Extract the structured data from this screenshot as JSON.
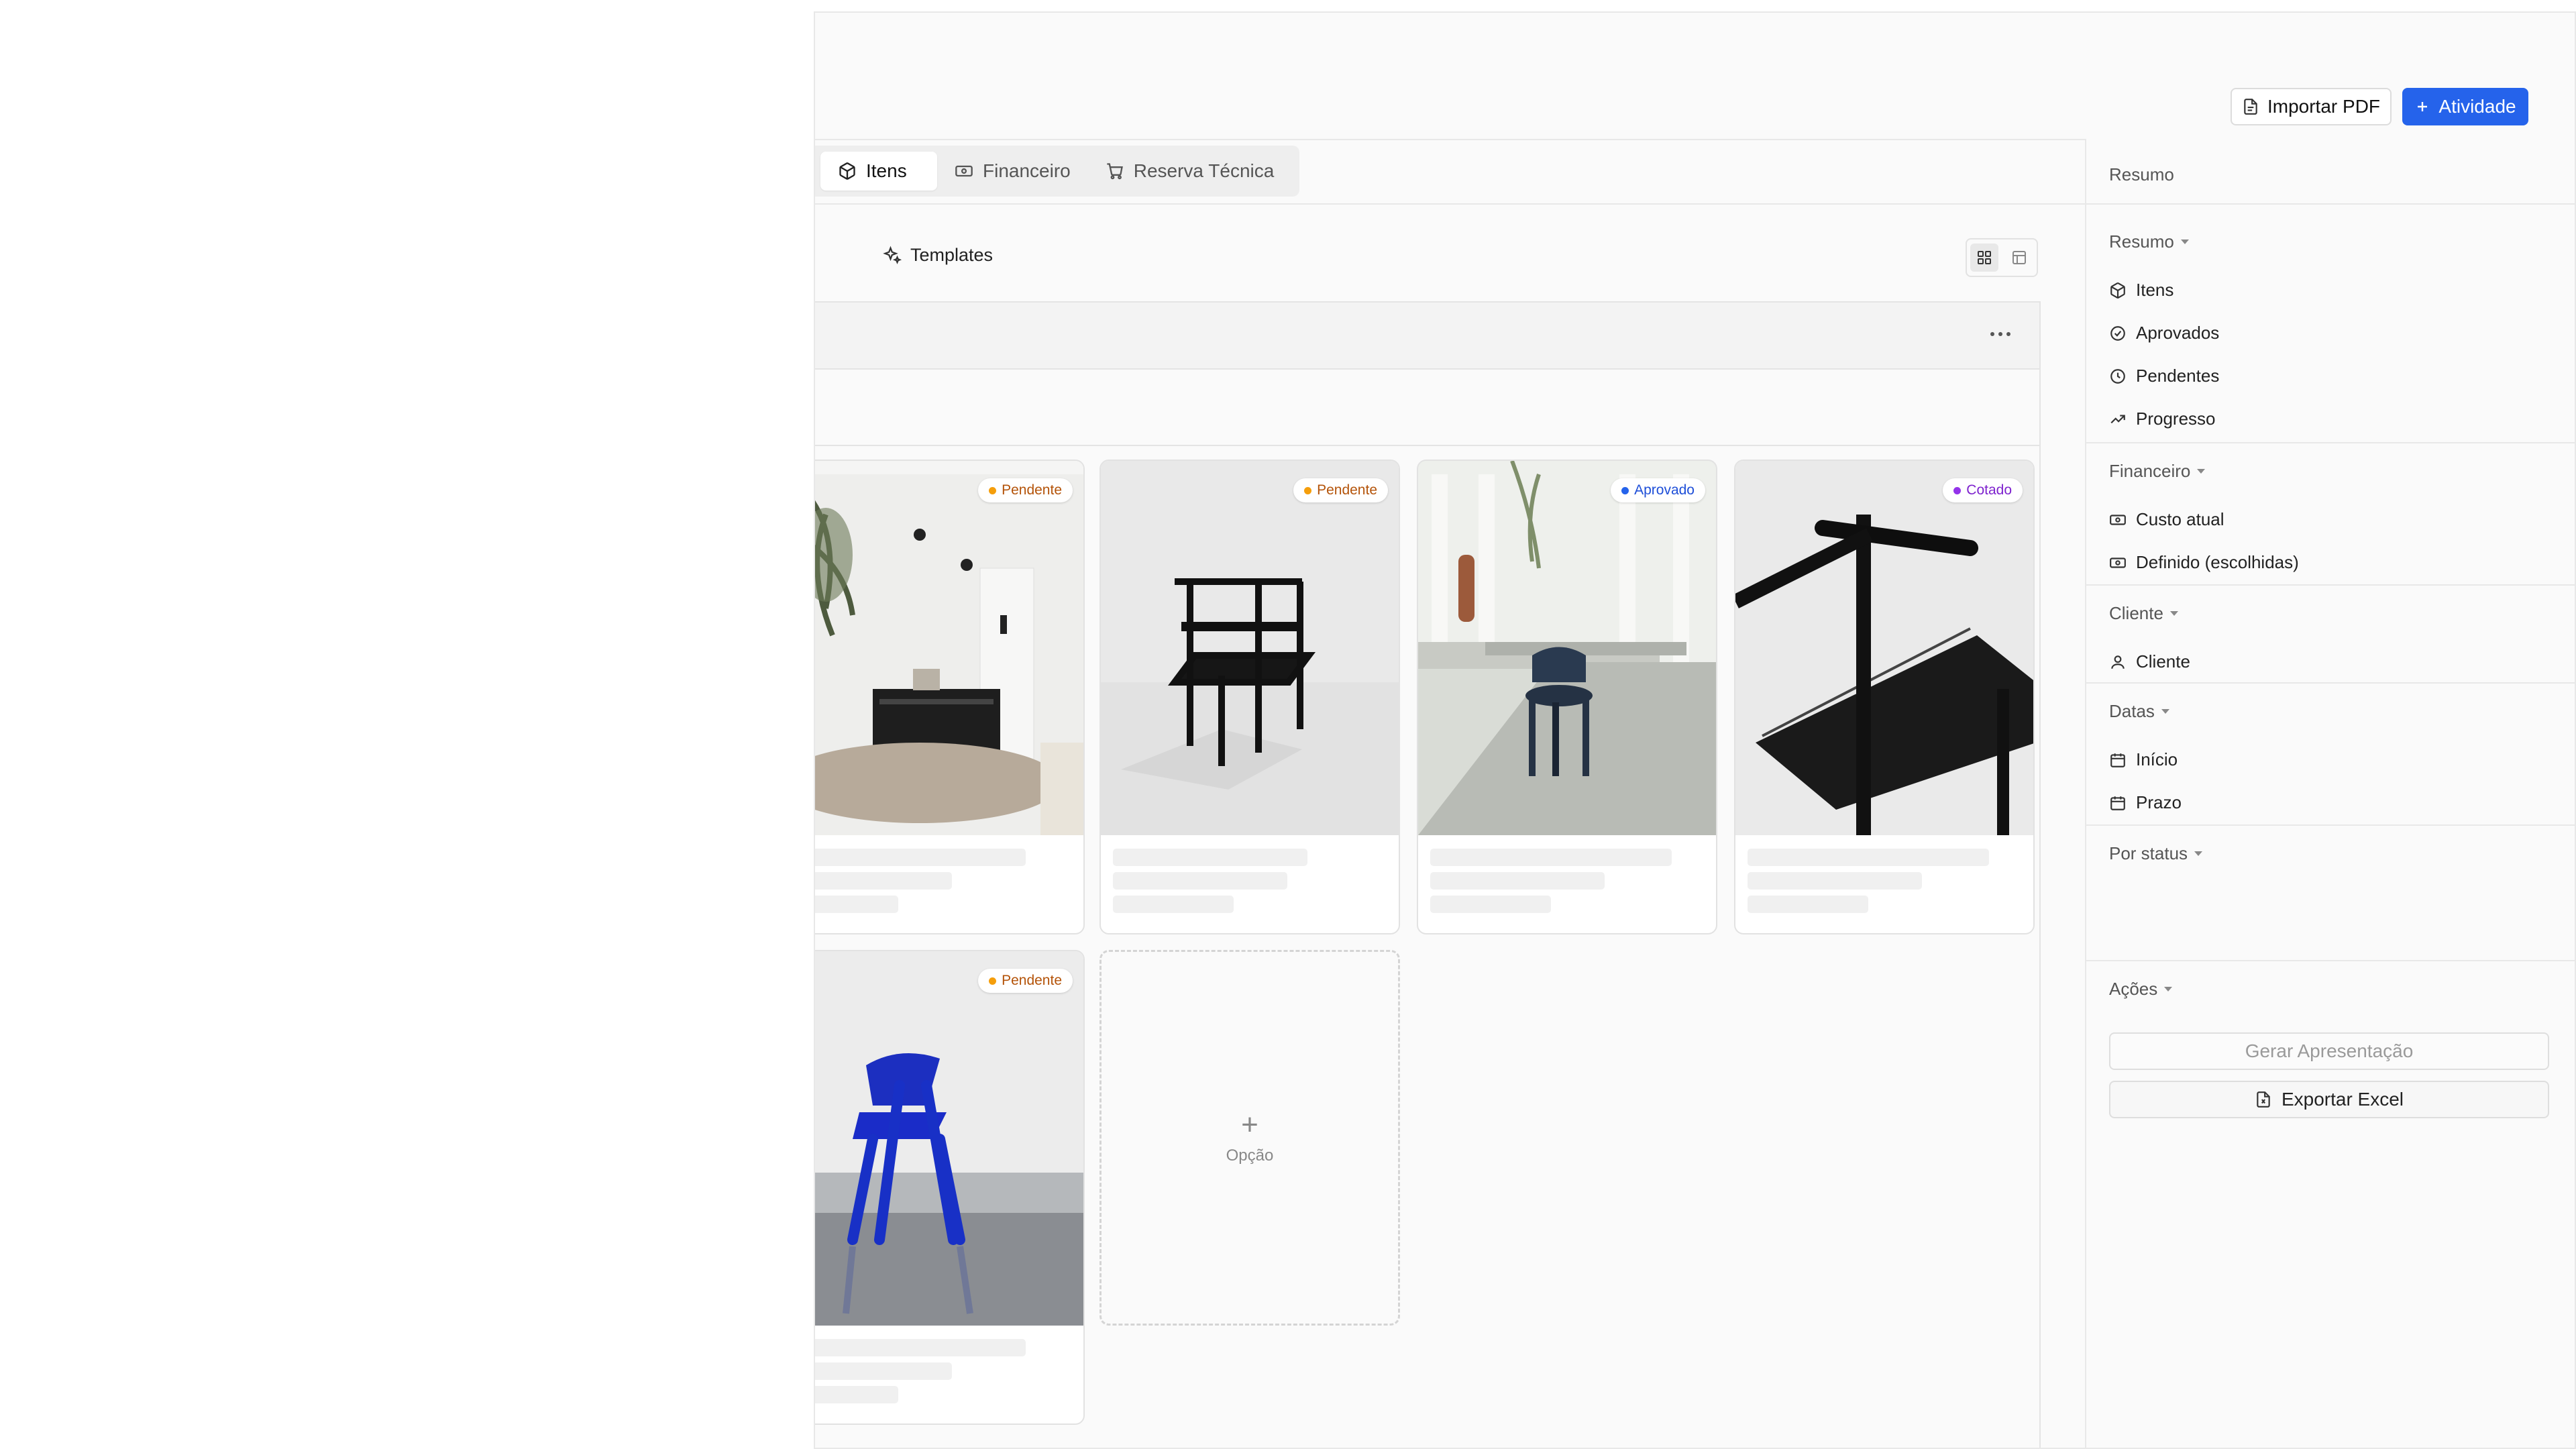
{
  "toolbar": {
    "import_pdf_label": "Importar PDF",
    "activity_label": "Atividade"
  },
  "tabs": [
    {
      "label": "Itens",
      "icon": "package-icon",
      "active": true
    },
    {
      "label": "Financeiro",
      "icon": "money-icon",
      "active": false
    },
    {
      "label": "Reserva Técnica",
      "icon": "cart-icon",
      "active": false
    }
  ],
  "templates_label": "Templates",
  "view_modes": [
    "grid",
    "table"
  ],
  "cards": [
    {
      "status": "Pendente",
      "status_color": "#f59e0b",
      "text_color": "#b45309",
      "image": "living room with bench and plant"
    },
    {
      "status": "Pendente",
      "status_color": "#f59e0b",
      "text_color": "#b45309",
      "image": "black chair"
    },
    {
      "status": "Aprovado",
      "status_color": "#2563eb",
      "text_color": "#1d4ed8",
      "image": "blue round stool in bright room"
    },
    {
      "status": "Cotado",
      "status_color": "#9333ea",
      "text_color": "#7e22ce",
      "image": "black chair close-up"
    },
    {
      "status": "Pendente",
      "status_color": "#f59e0b",
      "text_color": "#b45309",
      "image": "blue chair"
    }
  ],
  "add_option_label": "Opção",
  "panel": {
    "title": "Resumo",
    "sections": [
      {
        "label": "Resumo",
        "items": [
          {
            "label": "Itens",
            "icon": "package-icon"
          },
          {
            "label": "Aprovados",
            "icon": "check-circle-icon"
          },
          {
            "label": "Pendentes",
            "icon": "clock-icon"
          },
          {
            "label": "Progresso",
            "icon": "trending-up-icon"
          }
        ]
      },
      {
        "label": "Financeiro",
        "items": [
          {
            "label": "Custo atual",
            "icon": "money-icon"
          },
          {
            "label": "Definido (escolhidas)",
            "icon": "money-icon"
          }
        ]
      },
      {
        "label": "Cliente",
        "items": [
          {
            "label": "Cliente",
            "icon": "user-icon"
          }
        ]
      },
      {
        "label": "Datas",
        "items": [
          {
            "label": "Início",
            "icon": "calendar-icon"
          },
          {
            "label": "Prazo",
            "icon": "calendar-icon"
          }
        ]
      },
      {
        "label": "Por status",
        "items": []
      },
      {
        "label": "Ações",
        "items": []
      }
    ],
    "generate_presentation_label": "Gerar Apresentação",
    "export_excel_label": "Exportar Excel"
  },
  "colors": {
    "accent": "#2563eb",
    "pending": "#f59e0b",
    "approved": "#2563eb",
    "quoted": "#9333ea"
  }
}
